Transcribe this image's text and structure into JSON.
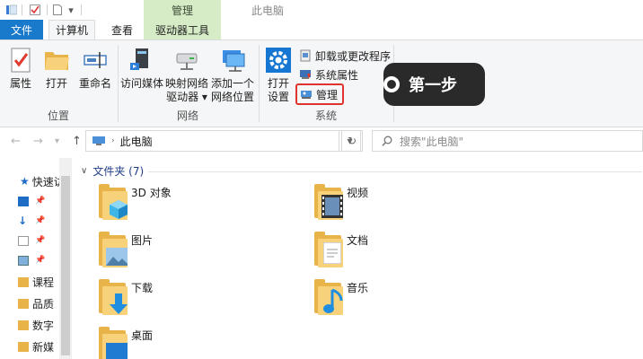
{
  "window": {
    "title": "此电脑",
    "context_tab": "管理"
  },
  "tabs": {
    "file": "文件",
    "computer": "计算机",
    "view": "查看",
    "drive_tools": "驱动器工具"
  },
  "ribbon": {
    "location": {
      "label": "位置",
      "properties": "属性",
      "open": "打开",
      "rename": "重命名"
    },
    "network": {
      "label": "网络",
      "access_media": "访问媒体",
      "map_drive_line1": "映射网络",
      "map_drive_line2": "驱动器",
      "add_location_line1": "添加一个",
      "add_location_line2": "网络位置"
    },
    "system": {
      "label": "系统",
      "open_settings_line1": "打开",
      "open_settings_line2": "设置",
      "uninstall": "卸载或更改程序",
      "system_properties": "系统属性",
      "manage": "管理"
    }
  },
  "callout": {
    "text": "第一步"
  },
  "address": {
    "path": "此电脑",
    "search_placeholder": "搜索\"此电脑\""
  },
  "nav_pane": {
    "quick_access": "快速访问",
    "items": [
      "课程",
      "品质",
      "数字",
      "新媒"
    ]
  },
  "content": {
    "section": "文件夹 (7)",
    "folders": [
      "3D 对象",
      "视频",
      "图片",
      "文档",
      "下载",
      "音乐",
      "桌面"
    ]
  },
  "colors": {
    "accent": "#1979ca",
    "highlight": "#e0332e",
    "context_tab_bg": "#d6ecc7",
    "folder": "#f7d27a"
  }
}
